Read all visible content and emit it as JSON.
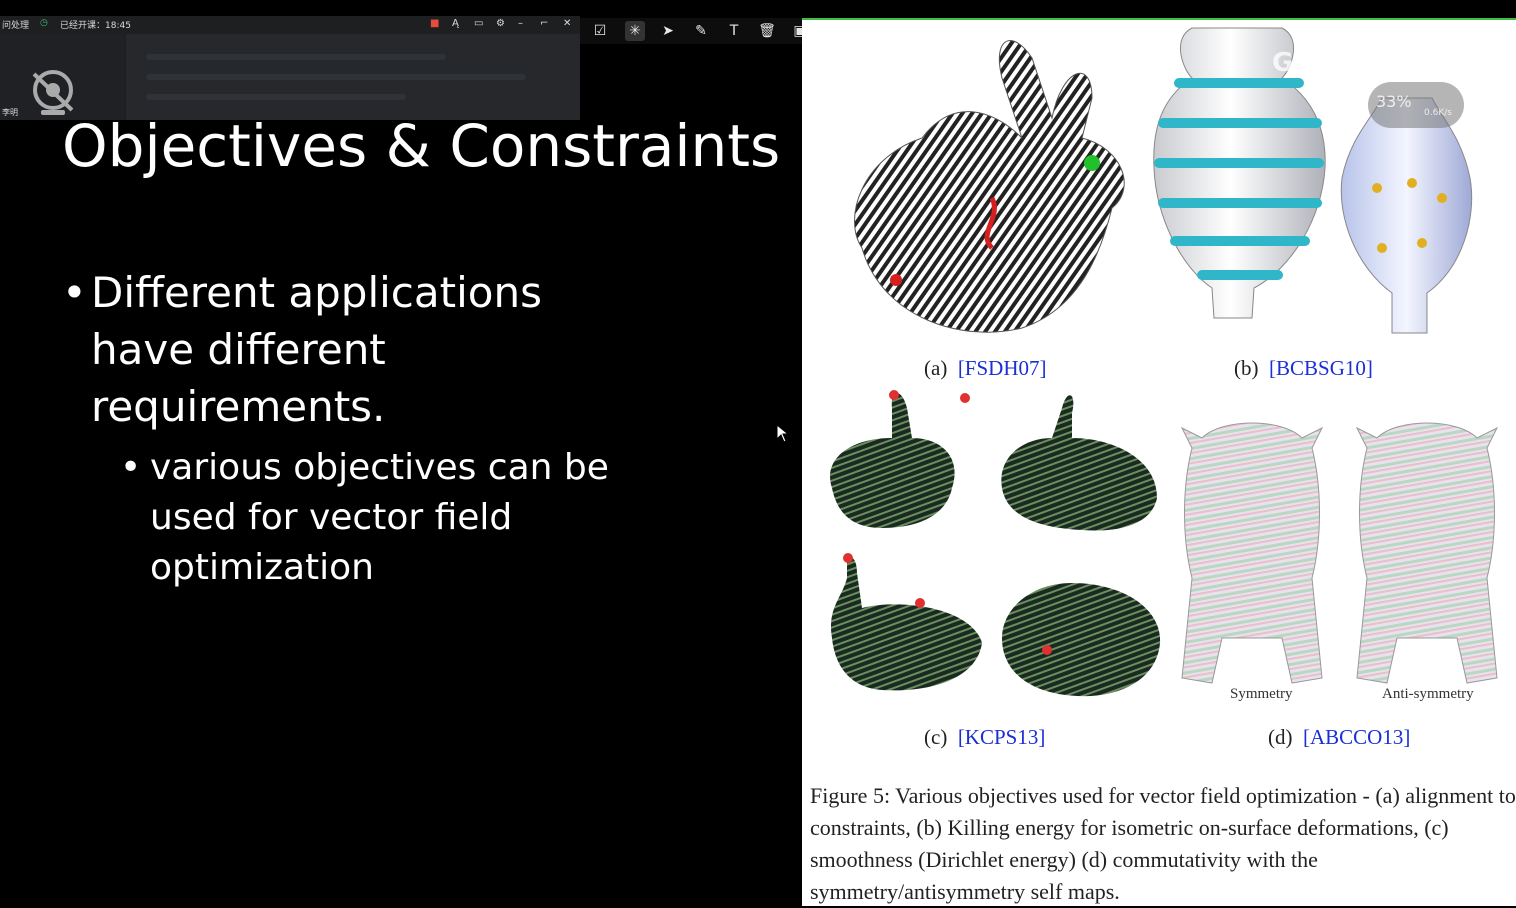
{
  "meeting": {
    "status_left": "问处理",
    "class_status": "已经开课：18:45",
    "nickname": "李明",
    "controls": [
      "●",
      "ᴬ",
      "▭",
      "⚙",
      "—",
      "⌐",
      "✕"
    ]
  },
  "annotation_toolbar": {
    "tools": [
      "select-box-icon",
      "laser-pointer-icon",
      "pointer-plus-icon",
      "pen-icon",
      "text-tool-icon",
      "eraser-icon",
      "clear-all-icon",
      "collapse-icon",
      "close-icon"
    ]
  },
  "slide": {
    "title": "Objectives & Constraints",
    "bullet1": "Different applications have different requirements.",
    "bullet2": "various objectives can be used for vector field optimization"
  },
  "figure": {
    "a_label": "(a)",
    "a_ref": "[FSDH07]",
    "b_label": "(b)",
    "b_ref": "[BCBSG10]",
    "c_label": "(c)",
    "c_ref": "[KCPS13]",
    "d_label": "(d)",
    "d_ref": "[ABCCO13]",
    "symmetry": "Symmetry",
    "antisymmetry": "Anti-symmetry",
    "caption": "Figure 5: Various objectives used for vector field optimization - (a) alignment to constraints, (b) Killing energy for isometric on-surface deformations, (c) smoothness (Dirichlet energy) (d) commutativity with the symmetry/antisymmetry self maps."
  },
  "player_overlay": {
    "logo": "GOL-F",
    "percent": "33%",
    "rate": "0.6K/s"
  },
  "colors": {
    "slide_bg": "#000000",
    "ref_blue": "#1a2fd6",
    "vase_stripe": "#2fb7c9"
  }
}
